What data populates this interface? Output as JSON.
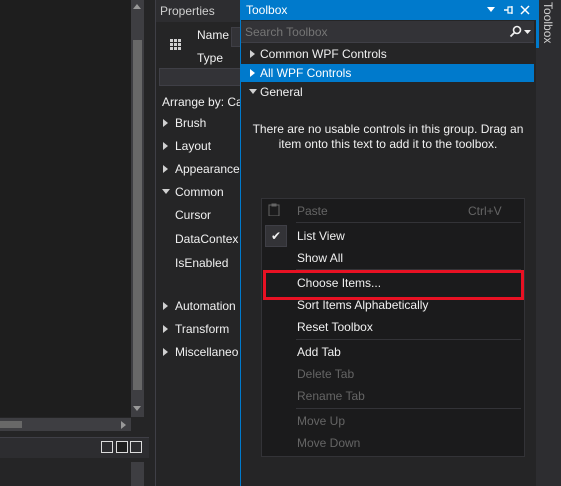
{
  "properties": {
    "title": "Properties",
    "name_label": "Name",
    "type_label": "Type",
    "arrange_by": "Arrange by: Ca",
    "categories": [
      {
        "label": "Brush",
        "expanded": false
      },
      {
        "label": "Layout",
        "expanded": false
      },
      {
        "label": "Appearance",
        "expanded": false
      },
      {
        "label": "Common",
        "expanded": true
      },
      {
        "label": "Automation",
        "expanded": false
      },
      {
        "label": "Transform",
        "expanded": false
      },
      {
        "label": "Miscellaneo",
        "expanded": false
      }
    ],
    "common_items": [
      "Cursor",
      "DataContex",
      "IsEnabled"
    ]
  },
  "toolbox": {
    "title": "Toolbox",
    "search_placeholder": "Search Toolbox",
    "groups": [
      {
        "label": "Common WPF Controls",
        "expanded": false,
        "selected": false
      },
      {
        "label": "All WPF Controls",
        "expanded": false,
        "selected": true
      },
      {
        "label": "General",
        "expanded": true,
        "selected": false
      }
    ],
    "empty_message": "There are no usable controls in this group. Drag an item onto this text to add it to the toolbox.",
    "side_tab": "Toolbox"
  },
  "context_menu": {
    "items": [
      {
        "label": "Paste",
        "shortcut": "Ctrl+V",
        "enabled": false
      },
      {
        "label": "List View",
        "checked": true,
        "enabled": true
      },
      {
        "label": "Show All",
        "enabled": true
      },
      {
        "label": "Choose Items...",
        "enabled": true,
        "highlighted": true
      },
      {
        "label": "Sort Items Alphabetically",
        "enabled": true
      },
      {
        "label": "Reset Toolbox",
        "enabled": true
      },
      {
        "label": "Add Tab",
        "enabled": true
      },
      {
        "label": "Delete Tab",
        "enabled": false
      },
      {
        "label": "Rename Tab",
        "enabled": false
      },
      {
        "label": "Move Up",
        "enabled": false
      },
      {
        "label": "Move Down",
        "enabled": false
      }
    ]
  },
  "colors": {
    "accent": "#007acc",
    "highlight_box": "#e81123",
    "background": "#252526",
    "menu_background": "#1b1b1c"
  }
}
